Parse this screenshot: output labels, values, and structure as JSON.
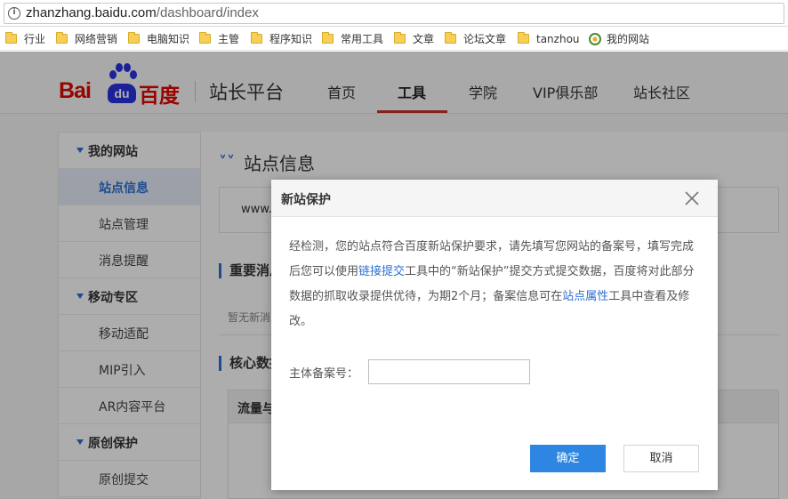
{
  "browser": {
    "url_host": "zhanzhang.baidu.com",
    "url_path": "/dashboard/index",
    "bookmarks": [
      {
        "label": "行业",
        "icon": "folder-icon"
      },
      {
        "label": "网络营销",
        "icon": "folder-icon"
      },
      {
        "label": "电脑知识",
        "icon": "folder-icon"
      },
      {
        "label": "主管",
        "icon": "folder-icon"
      },
      {
        "label": "程序知识",
        "icon": "folder-icon"
      },
      {
        "label": "常用工具",
        "icon": "folder-icon"
      },
      {
        "label": "文章",
        "icon": "folder-icon"
      },
      {
        "label": "论坛文章",
        "icon": "folder-icon"
      },
      {
        "label": "tanzhou",
        "icon": "folder-icon"
      },
      {
        "label": "我的网站",
        "icon": "globe-icon"
      }
    ]
  },
  "header": {
    "logo_text_latin": "Bai",
    "logo_text_du": "du",
    "logo_text_cn": "百度",
    "platform_name": "站长平台",
    "nav": [
      {
        "label": "首页",
        "active": false
      },
      {
        "label": "工具",
        "active": true
      },
      {
        "label": "学院",
        "active": false
      },
      {
        "label": "VIP俱乐部",
        "active": false
      },
      {
        "label": "站长社区",
        "active": false
      }
    ]
  },
  "sidebar": {
    "groups": [
      {
        "label": "我的网站",
        "items": [
          "站点信息",
          "站点管理",
          "消息提醒"
        ]
      },
      {
        "label": "移动专区",
        "items": [
          "移动适配",
          "MIP引入",
          "AR内容平台"
        ]
      },
      {
        "label": "原创保护",
        "items": [
          "原创提交"
        ]
      }
    ],
    "active_item": "站点信息"
  },
  "main": {
    "title": "站点信息",
    "site_prefix": "www.",
    "section_important": "重要消息",
    "empty_note": "暂无新消息",
    "section_core": "核心数据",
    "table_header": "流量与"
  },
  "modal": {
    "title": "新站保护",
    "body_parts": [
      "经检测，您的站点符合百度新站保护要求，请先填写您网站的备案号，填写完成后您可以使用",
      "链接提交",
      "工具中的“新站保护”提交方式提交数据，百度将对此部分数据的抓取收录提供优待，为期2个月；备案信息可在",
      "站点属性",
      "工具中查看及修改。"
    ],
    "field_label": "主体备案号：",
    "field_value": "",
    "field_placeholder": "",
    "confirm_label": "确定",
    "cancel_label": "取消"
  },
  "colors": {
    "accent_blue": "#2d86e1",
    "link_blue": "#2d6fd3",
    "nav_active_underline": "#c8312f",
    "baidu_red": "#e10601"
  }
}
